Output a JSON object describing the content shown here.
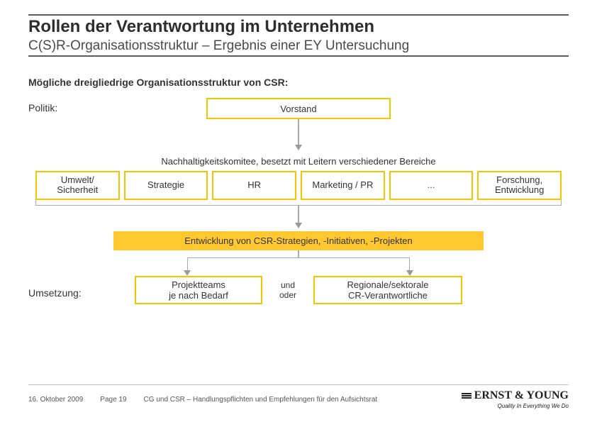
{
  "header": {
    "title": "Rollen der Verantwortung im Unternehmen",
    "subtitle": "C(S)R-Organisationsstruktur – Ergebnis einer EY Untersuchung"
  },
  "intro": "Mögliche dreigliedrige Organisationsstruktur von CSR:",
  "labels": {
    "politik": "Politik:",
    "umsetzung": "Umsetzung:"
  },
  "diagram": {
    "top_box": "Vorstand",
    "committee_label": "Nachhaltigkeitskomitee, besetzt mit Leitern verschiedener Bereiche",
    "committee_boxes": [
      "Umwelt/\nSicherheit",
      "Strategie",
      "HR",
      "Marketing / PR",
      "…",
      "Forschung, Entwicklung"
    ],
    "gold_band": "Entwicklung von CSR-Strategien, -Initiativen, -Projekten",
    "bottom_left": "Projektteams\nje nach Bedarf",
    "bottom_mid": "und\noder",
    "bottom_right": "Regionale/sektorale\nCR-Verantwortliche"
  },
  "footer": {
    "date": "16. Oktober 2009",
    "page": "Page 19",
    "doc_title": "CG und CSR – Handlungspflichten und Empfehlungen für den Aufsichtsrat",
    "brand": "ERNST & YOUNG",
    "tagline": "Quality In Everything We Do"
  }
}
